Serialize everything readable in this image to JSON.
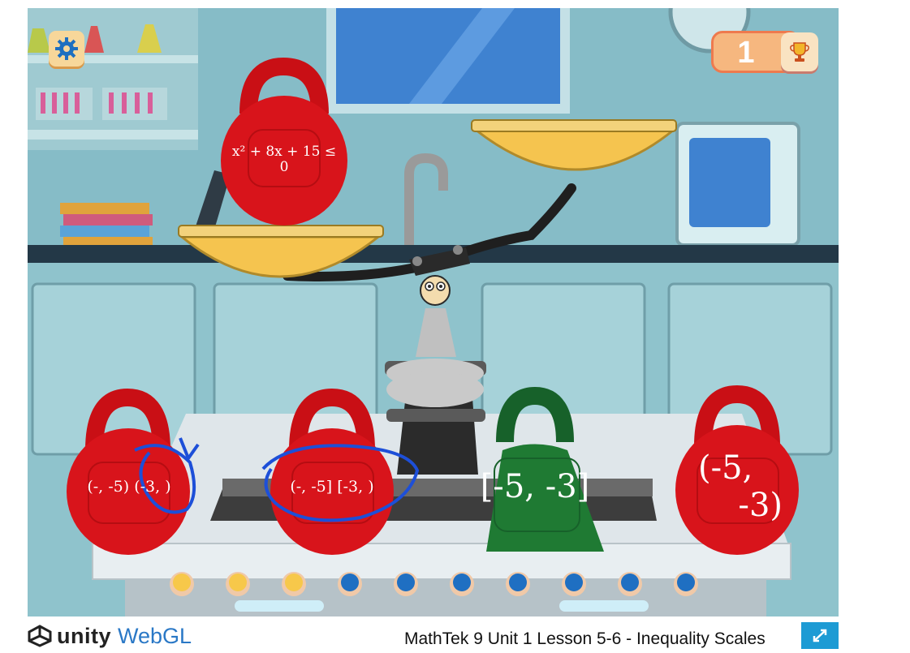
{
  "game": {
    "score": "1",
    "equation_weight": {
      "line1": "x² + 8x + 15 ≤",
      "line2": "0"
    },
    "answer_weights": [
      {
        "label": "(-, -5) (-3, )",
        "color": "red"
      },
      {
        "label": "(-, -5] [-3, )",
        "color": "red"
      },
      {
        "label": "[-5, -3]",
        "color": "green"
      },
      {
        "label_line1": "(-5,",
        "label_line2": "-3)",
        "color": "red"
      }
    ],
    "progress": {
      "completed": 3,
      "total": 10
    },
    "colors": {
      "red_weight": "#d8141b",
      "green_weight": "#1f7a33",
      "pan_gold": "#f5c44f",
      "progress_done": "#f7c84a",
      "progress_todo": "#1f6fc2",
      "annotation_ink": "#1d4fd8"
    }
  },
  "footer": {
    "brand_unity": "unity",
    "brand_webgl": "WebGL",
    "title": "MathTek 9 Unit 1 Lesson 5-6 - Inequality Scales"
  },
  "icons": {
    "settings": "gear-icon",
    "score": "trophy-icon",
    "fullscreen": "expand-icon",
    "logo": "unity-logo-icon"
  }
}
